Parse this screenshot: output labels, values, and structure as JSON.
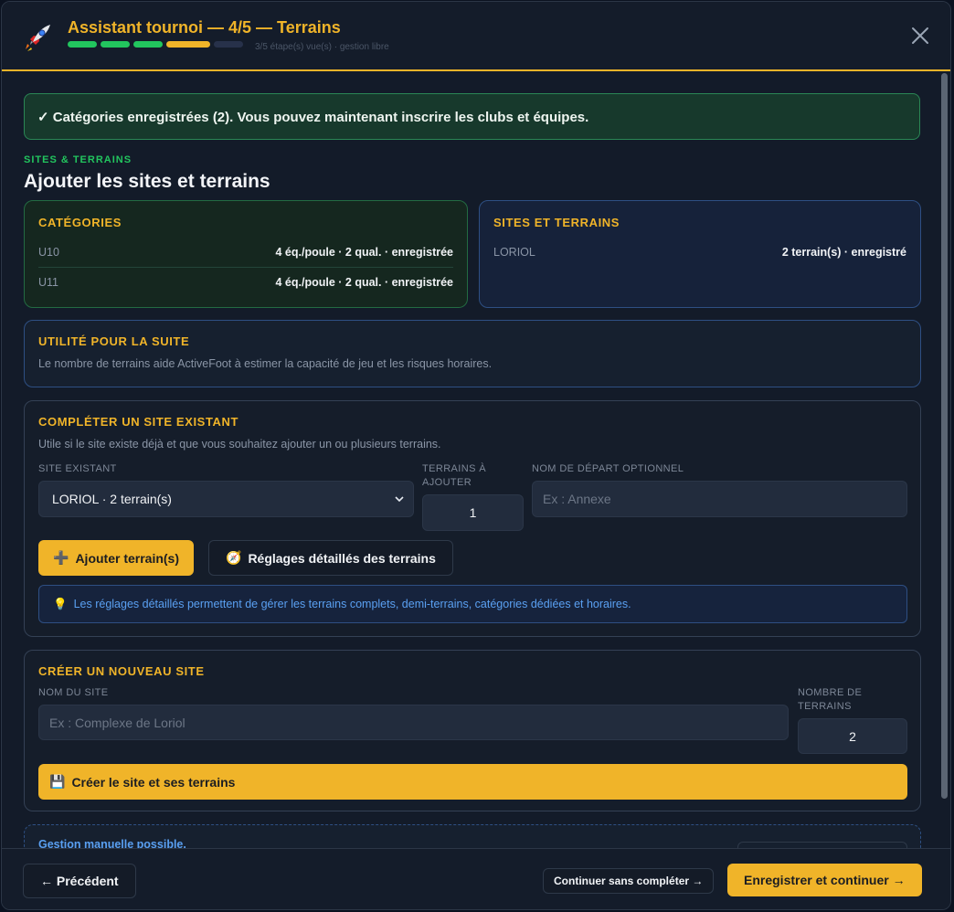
{
  "header": {
    "title": "Assistant tournoi — 4/5 — Terrains",
    "progress_steps": [
      "done",
      "done",
      "done",
      "current",
      "todo"
    ],
    "progress_note": "3/5 étape(s) vue(s) · gestion libre"
  },
  "alert": {
    "text": "✓ Catégories enregistrées (2). Vous pouvez maintenant inscrire les clubs et équipes."
  },
  "section": {
    "eyebrow": "SITES & TERRAINS",
    "title": "Ajouter les sites et terrains"
  },
  "categories": {
    "title": "CATÉGORIES",
    "rows": [
      {
        "name": "U10",
        "value": "4 éq./poule · 2 qual. · enregistrée"
      },
      {
        "name": "U11",
        "value": "4 éq./poule · 2 qual. · enregistrée"
      }
    ]
  },
  "sites": {
    "title": "SITES ET TERRAINS",
    "rows": [
      {
        "name": "LORIOL",
        "value": "2 terrain(s) · enregistré"
      }
    ]
  },
  "utility": {
    "title": "UTILITÉ POUR LA SUITE",
    "text": "Le nombre de terrains aide ActiveFoot à estimer la capacité de jeu et les risques horaires."
  },
  "existing": {
    "title": "COMPLÉTER UN SITE EXISTANT",
    "subtitle": "Utile si le site existe déjà et que vous souhaitez ajouter un ou plusieurs terrains.",
    "site_label": "SITE EXISTANT",
    "site_value": "LORIOL · 2 terrain(s)",
    "count_label_line1": "TERRAINS À",
    "count_label_line2": "AJOUTER",
    "count_value": "1",
    "name_label": "NOM DE DÉPART OPTIONNEL",
    "name_placeholder": "Ex : Annexe",
    "add_button_icon": "➕",
    "add_button": "Ajouter terrain(s)",
    "settings_button_icon": "🧭",
    "settings_button": "Réglages détaillés des terrains",
    "hint_icon": "💡",
    "hint": "Les réglages détaillés permettent de gérer les terrains complets, demi-terrains, catégories dédiées et horaires."
  },
  "new_site": {
    "title": "CRÉER UN NOUVEAU SITE",
    "name_label": "NOM DU SITE",
    "name_placeholder": "Ex : Complexe de Loriol",
    "count_label_line1": "NOMBRE DE",
    "count_label_line2": "TERRAINS",
    "count_value": "2",
    "create_button_icon": "💾",
    "create_button": "Créer le site et ses terrains"
  },
  "manual": {
    "text": "Gestion manuelle possible."
  },
  "footer": {
    "prev": "← Précédent",
    "skip": "Continuer sans compléter →",
    "save": "Enregistrer et continuer →"
  },
  "colors": {
    "accent": "#f0b429",
    "success": "#22c55e",
    "info": "#5aa0f2",
    "background": "#131b29"
  }
}
